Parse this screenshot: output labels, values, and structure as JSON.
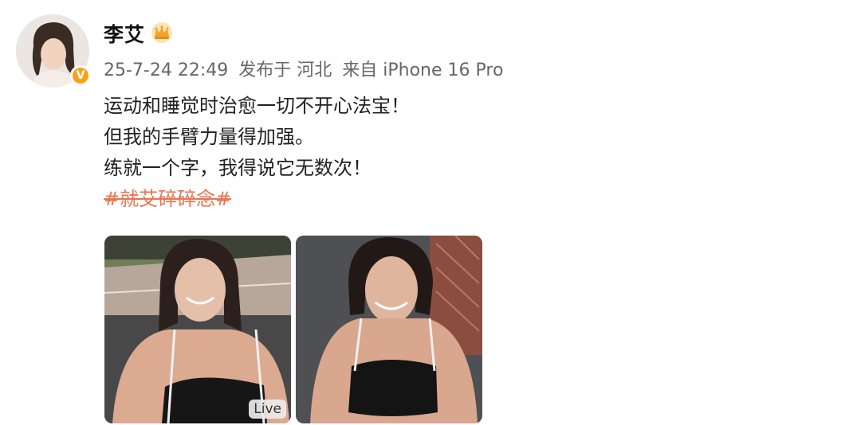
{
  "post": {
    "author": {
      "name": "李艾",
      "avatar_icon": "avatar-photo",
      "verified_icon": "verified-badge-icon",
      "verified_symbol": "V",
      "vip_icon": "crown-icon"
    },
    "meta": {
      "timestamp": "25-7-24 22:49",
      "location": "发布于 河北",
      "source": "来自 iPhone 16 Pro"
    },
    "text_lines": [
      "运动和睡觉时治愈一切不开心法宝！",
      "但我的手臂力量得加强。",
      "练就一个字，我得说它无数次！"
    ],
    "hashtag": "#就艾碎碎念#",
    "images": [
      {
        "badge": "Live"
      },
      {
        "badge": ""
      }
    ],
    "colors": {
      "hashtag": "#eb7350",
      "meta": "#666666",
      "text": "#222222",
      "verified": "#f6a31b"
    }
  }
}
